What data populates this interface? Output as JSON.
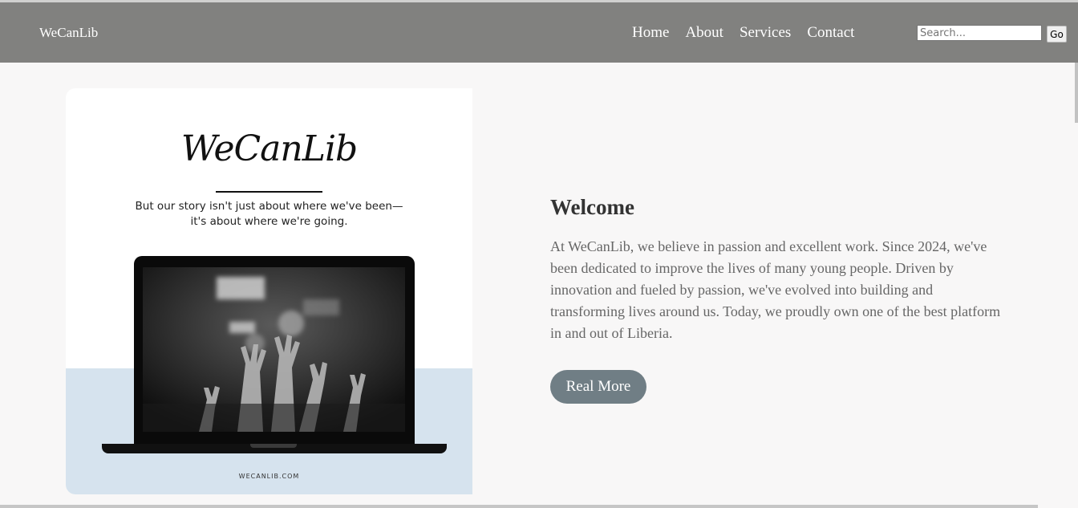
{
  "brand": "WeCanLib",
  "nav": {
    "home": "Home",
    "about": "About",
    "services": "Services",
    "contact": "Contact"
  },
  "search": {
    "placeholder": "Search...",
    "button": "Go"
  },
  "hero": {
    "logo": "WeCanLib",
    "tagline": "But our story isn't just about where we've been—it's about where we're going.",
    "url": "WECANLIB.COM"
  },
  "welcome": {
    "title": "Welcome",
    "body": "At WeCanLib, we believe in passion and excellent work. Since 2024, we've been dedicated to improve the lives of many young people. Driven by innovation and fueled by passion, we've evolved into building and transforming lives around us. Today, we proudly own one of the best platform in and out of Liberia.",
    "button": "Real More"
  },
  "colors": {
    "navbar": "#81817f",
    "page": "#f8f7f7",
    "button": "#707e85",
    "card_blue": "#d6e3ee"
  }
}
